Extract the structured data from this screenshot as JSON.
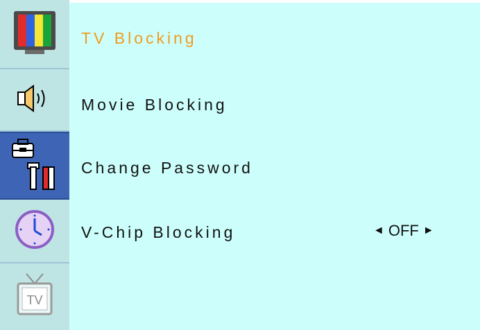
{
  "sidebar": {
    "icons": [
      {
        "name": "tv-picture-icon"
      },
      {
        "name": "speaker-icon"
      },
      {
        "name": "toolbox-icon"
      },
      {
        "name": "clock-icon"
      },
      {
        "name": "tv-channel-icon",
        "label": "TV"
      }
    ]
  },
  "menu": {
    "items": [
      {
        "label": "TV Blocking",
        "selected": true
      },
      {
        "label": "Movie Blocking"
      },
      {
        "label": "Change Password"
      },
      {
        "label": "V-Chip Blocking",
        "value": "OFF"
      }
    ]
  },
  "colors": {
    "content_bg": "#ccfffb",
    "sidebar_bg": "#bfe4e4",
    "selected_tab_bg": "#3e64b5",
    "selected_text": "#f29a1d"
  }
}
